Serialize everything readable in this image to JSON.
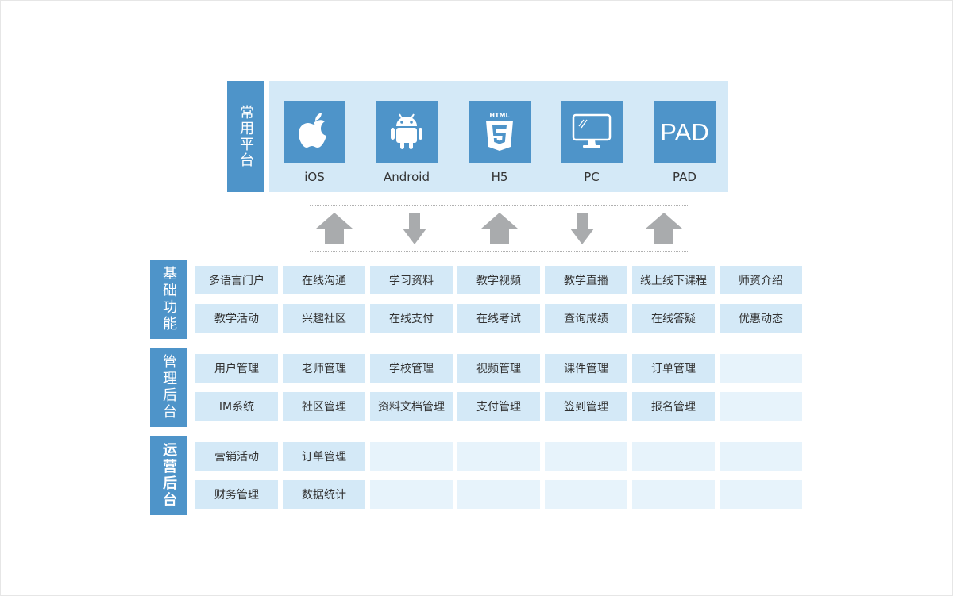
{
  "platform": {
    "label": "常用平台",
    "items": [
      {
        "name": "iOS",
        "icon": "apple-icon"
      },
      {
        "name": "Android",
        "icon": "android-icon"
      },
      {
        "name": "H5",
        "icon": "html5-icon",
        "badge": "HTML",
        "badge_num": "5"
      },
      {
        "name": "PC",
        "icon": "monitor-icon"
      },
      {
        "name": "PAD",
        "icon": "pad-icon",
        "badge": "PAD"
      }
    ]
  },
  "arrows": [
    "up",
    "down",
    "up",
    "down",
    "up"
  ],
  "sections": [
    {
      "label": "基础功能",
      "rows": [
        [
          "多语言门户",
          "在线沟通",
          "学习资料",
          "教学视频",
          "教学直播",
          "线上线下课程",
          "师资介绍"
        ],
        [
          "教学活动",
          "兴趣社区",
          "在线支付",
          "在线考试",
          "查询成绩",
          "在线答疑",
          "优惠动态"
        ]
      ]
    },
    {
      "label": "管理后台",
      "rows": [
        [
          "用户管理",
          "老师管理",
          "学校管理",
          "视频管理",
          "课件管理",
          "订单管理",
          ""
        ],
        [
          "IM系统",
          "社区管理",
          "资料文档管理",
          "支付管理",
          "签到管理",
          "报名管理",
          ""
        ]
      ]
    },
    {
      "label": "运营后台",
      "rows": [
        [
          "营销活动",
          "订单管理",
          "",
          "",
          "",
          "",
          ""
        ],
        [
          "财务管理",
          "数据统计",
          "",
          "",
          "",
          "",
          ""
        ]
      ]
    }
  ],
  "colors": {
    "accent": "#4e94c9",
    "cell": "#d4e9f7",
    "cell_empty": "#e7f3fb",
    "arrow": "#a9abad"
  }
}
